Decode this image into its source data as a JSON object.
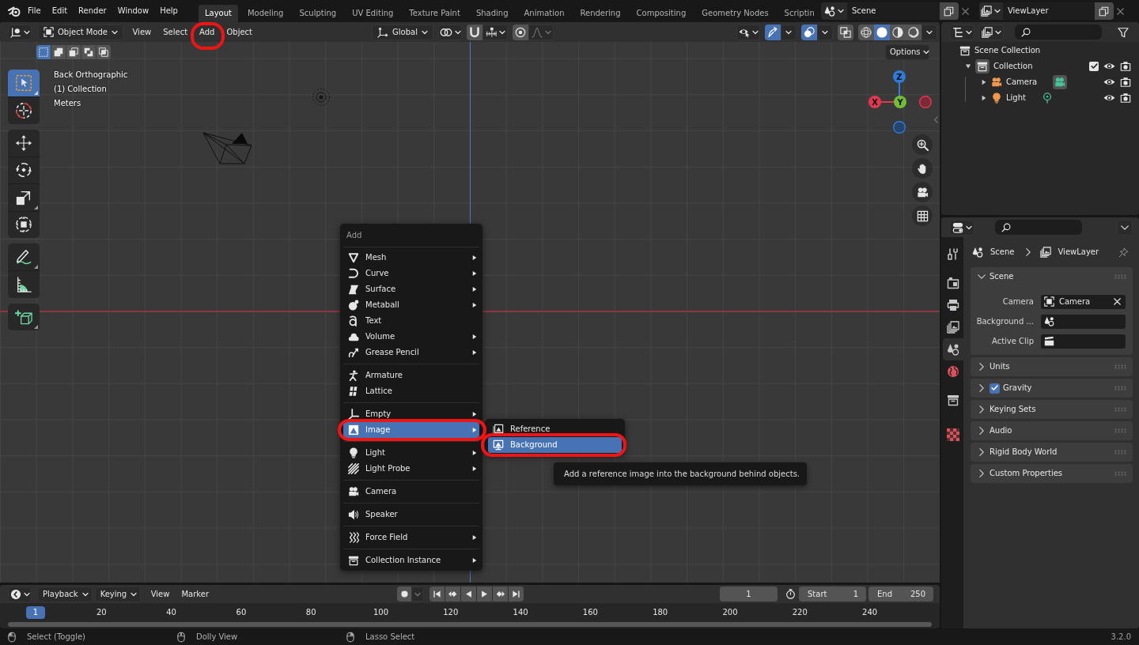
{
  "top_bar": {
    "menus": [
      "File",
      "Edit",
      "Render",
      "Window",
      "Help"
    ],
    "workspaces": [
      {
        "label": "Layout",
        "selected": true
      },
      {
        "label": "Modeling",
        "selected": false
      },
      {
        "label": "Sculpting",
        "selected": false
      },
      {
        "label": "UV Editing",
        "selected": false
      },
      {
        "label": "Texture Paint",
        "selected": false
      },
      {
        "label": "Shading",
        "selected": false
      },
      {
        "label": "Animation",
        "selected": false
      },
      {
        "label": "Rendering",
        "selected": false
      },
      {
        "label": "Compositing",
        "selected": false
      },
      {
        "label": "Geometry Nodes",
        "selected": false
      },
      {
        "label": "Scriptin",
        "selected": false
      }
    ],
    "scene": "Scene",
    "view_layer": "ViewLayer"
  },
  "viewport": {
    "header": {
      "mode": "Object Mode",
      "menus": [
        {
          "label": "View",
          "highlighted": false
        },
        {
          "label": "Select",
          "highlighted": false
        },
        {
          "label": "Add",
          "highlighted": true
        },
        {
          "label": "Object",
          "highlighted": false
        }
      ],
      "orientation": "Global",
      "snap": {
        "on": false
      },
      "proportional": {
        "on": false
      },
      "gizmos": {
        "on": true
      },
      "overlays": {
        "on": true
      },
      "xray": {
        "on": false
      },
      "shading": [
        {
          "kind": "wireframe",
          "selected": false
        },
        {
          "kind": "solid",
          "selected": true
        },
        {
          "kind": "material",
          "selected": false
        },
        {
          "kind": "rendered",
          "selected": false
        }
      ]
    },
    "select_modes": [
      {
        "kind": "set",
        "selected": true
      },
      {
        "kind": "extend",
        "selected": false
      },
      {
        "kind": "subtract",
        "selected": false
      },
      {
        "kind": "difference",
        "selected": false
      },
      {
        "kind": "intersect",
        "selected": false
      }
    ],
    "options": "Options",
    "info": [
      "Back Orthographic",
      "(1) Collection",
      "Meters"
    ],
    "tool_groups": [
      {
        "tools": [
          {
            "kind": "select_box",
            "selected": true,
            "variants": true
          },
          {
            "kind": "cursor",
            "selected": false,
            "variants": false
          }
        ]
      },
      {
        "tools": [
          {
            "kind": "move",
            "selected": false,
            "variants": false
          },
          {
            "kind": "rotate",
            "selected": false,
            "variants": false
          },
          {
            "kind": "scale",
            "selected": false,
            "variants": true
          },
          {
            "kind": "transform",
            "selected": false,
            "variants": false
          }
        ]
      },
      {
        "tools": [
          {
            "kind": "annotate",
            "selected": false,
            "variants": true
          },
          {
            "kind": "measure",
            "selected": false,
            "variants": false
          }
        ]
      },
      {
        "tools": [
          {
            "kind": "add_cube",
            "selected": false,
            "variants": true
          }
        ]
      }
    ],
    "gizmo_axes": [
      {
        "kind": "z",
        "label": "Z"
      },
      {
        "kind": "y",
        "label": "Y"
      },
      {
        "kind": "x",
        "label": "X"
      }
    ],
    "nav_buttons": [
      {
        "kind": "zoom"
      },
      {
        "kind": "pan"
      },
      {
        "kind": "camera"
      },
      {
        "kind": "ortho"
      }
    ]
  },
  "add_menu": {
    "title": "Add",
    "sections": [
      {
        "items": [
          {
            "kind": "mesh",
            "label": "Mesh",
            "submenu": true,
            "selected": false,
            "highlighted": false
          },
          {
            "kind": "curve",
            "label": "Curve",
            "submenu": true,
            "selected": false,
            "highlighted": false
          },
          {
            "kind": "surface",
            "label": "Surface",
            "submenu": true,
            "selected": false,
            "highlighted": false
          },
          {
            "kind": "metaball",
            "label": "Metaball",
            "submenu": true,
            "selected": false,
            "highlighted": false
          },
          {
            "kind": "text",
            "label": "Text",
            "submenu": false,
            "selected": false,
            "highlighted": false
          },
          {
            "kind": "volume",
            "label": "Volume",
            "submenu": true,
            "selected": false,
            "highlighted": false
          },
          {
            "kind": "grease_pencil",
            "label": "Grease Pencil",
            "submenu": true,
            "selected": false,
            "highlighted": false
          }
        ]
      },
      {
        "items": [
          {
            "kind": "armature",
            "label": "Armature",
            "submenu": false,
            "selected": false,
            "highlighted": false
          },
          {
            "kind": "lattice",
            "label": "Lattice",
            "submenu": false,
            "selected": false,
            "highlighted": false
          }
        ]
      },
      {
        "items": [
          {
            "kind": "empty",
            "label": "Empty",
            "submenu": true,
            "selected": false,
            "highlighted": false
          },
          {
            "kind": "image",
            "label": "Image",
            "submenu": true,
            "selected": true,
            "highlighted": true
          }
        ]
      },
      {
        "items": [
          {
            "kind": "light",
            "label": "Light",
            "submenu": true,
            "selected": false,
            "highlighted": false
          },
          {
            "kind": "light_probe",
            "label": "Light Probe",
            "submenu": true,
            "selected": false,
            "highlighted": false
          }
        ]
      },
      {
        "items": [
          {
            "kind": "camera",
            "label": "Camera",
            "submenu": false,
            "selected": false,
            "highlighted": false
          }
        ]
      },
      {
        "items": [
          {
            "kind": "speaker",
            "label": "Speaker",
            "submenu": false,
            "selected": false,
            "highlighted": false
          }
        ]
      },
      {
        "items": [
          {
            "kind": "force_field",
            "label": "Force Field",
            "submenu": true,
            "selected": false,
            "highlighted": false
          }
        ]
      },
      {
        "items": [
          {
            "kind": "collection_instance",
            "label": "Collection Instance",
            "submenu": true,
            "selected": false,
            "highlighted": false
          }
        ]
      }
    ]
  },
  "image_submenu": {
    "items": [
      {
        "kind": "reference",
        "label": "Reference",
        "submenu": false,
        "selected": false,
        "highlighted": false
      },
      {
        "kind": "background",
        "label": "Background",
        "submenu": false,
        "selected": true,
        "highlighted": true
      }
    ]
  },
  "tooltip": "Add a reference image into the background behind objects.",
  "outliner": {
    "tree": [
      {
        "kind": "collection",
        "label": "Scene Collection",
        "active": false,
        "children": [
          {
            "kind": "collection",
            "label": "Collection",
            "active": true,
            "expanded": true,
            "checked": true,
            "visible": true,
            "renderable": true,
            "children": [
              {
                "kind": "camera",
                "label": "Camera",
                "active": false,
                "expanded": false,
                "visible": true,
                "renderable": true,
                "data": {
                  "kind": "camera",
                  "active": true
                }
              },
              {
                "kind": "light",
                "label": "Light",
                "active": false,
                "expanded": false,
                "visible": true,
                "renderable": true,
                "data": {
                  "kind": "light",
                  "active": false
                }
              }
            ]
          }
        ]
      }
    ]
  },
  "properties": {
    "tab_groups": [
      {
        "tabs": [
          {
            "kind": "tool",
            "selected": false
          }
        ]
      },
      {
        "tabs": [
          {
            "kind": "render",
            "selected": false
          },
          {
            "kind": "output",
            "selected": false
          },
          {
            "kind": "view_layer",
            "selected": false
          },
          {
            "kind": "scene",
            "selected": true
          },
          {
            "kind": "world",
            "selected": false
          }
        ]
      },
      {
        "tabs": [
          {
            "kind": "collection",
            "selected": false
          }
        ]
      },
      {
        "tabs": [
          {
            "kind": "texture",
            "selected": false
          }
        ]
      }
    ],
    "breadcrumb": [
      {
        "kind": "scene",
        "label": "Scene"
      },
      {
        "kind": "view_layer",
        "label": "ViewLayer"
      }
    ],
    "panels": [
      {
        "kind": "plain",
        "title": "Scene",
        "expanded": true,
        "fields": [
          {
            "kind": "object",
            "label": "Camera",
            "value": "Camera",
            "clearable": true
          },
          {
            "kind": "scene",
            "label": "Background ...",
            "clearable": false
          },
          {
            "kind": "clip",
            "label": "Active Clip",
            "clearable": false
          }
        ]
      },
      {
        "kind": "plain",
        "title": "Units",
        "expanded": false
      },
      {
        "kind": "toggle",
        "title": "Gravity",
        "expanded": false,
        "checked": true
      },
      {
        "kind": "plain",
        "title": "Keying Sets",
        "expanded": false
      },
      {
        "kind": "plain",
        "title": "Audio",
        "expanded": false
      },
      {
        "kind": "plain",
        "title": "Rigid Body World",
        "expanded": false
      },
      {
        "kind": "plain",
        "title": "Custom Properties",
        "expanded": false
      }
    ]
  },
  "timeline": {
    "menus": [
      {
        "kind": "dropdown",
        "label": "Playback"
      },
      {
        "kind": "dropdown",
        "label": "Keying"
      },
      {
        "kind": "plain",
        "label": "View"
      },
      {
        "kind": "plain",
        "label": "Marker"
      }
    ],
    "transport": [
      {
        "kind": "jump_start"
      },
      {
        "kind": "prev_key"
      },
      {
        "kind": "play_reverse"
      },
      {
        "kind": "play"
      },
      {
        "kind": "next_key"
      },
      {
        "kind": "jump_end"
      }
    ],
    "current_frame": "1",
    "start": {
      "label": "Start",
      "value": "1"
    },
    "end": {
      "label": "End",
      "value": "250"
    },
    "ruler": [
      {
        "label": "1",
        "selected": true
      },
      {
        "label": "20",
        "selected": false
      },
      {
        "label": "40",
        "selected": false
      },
      {
        "label": "60",
        "selected": false
      },
      {
        "label": "80",
        "selected": false
      },
      {
        "label": "100",
        "selected": false
      },
      {
        "label": "120",
        "selected": false
      },
      {
        "label": "140",
        "selected": false
      },
      {
        "label": "160",
        "selected": false
      },
      {
        "label": "180",
        "selected": false
      },
      {
        "label": "200",
        "selected": false
      },
      {
        "label": "220",
        "selected": false
      },
      {
        "label": "240",
        "selected": false
      }
    ]
  },
  "status_bar": {
    "hints": [
      {
        "kind": "left",
        "label": "Select (Toggle)"
      },
      {
        "kind": "middle",
        "label": "Dolly View"
      },
      {
        "kind": "right",
        "label": "Lasso Select"
      }
    ],
    "version": "3.2.0"
  }
}
